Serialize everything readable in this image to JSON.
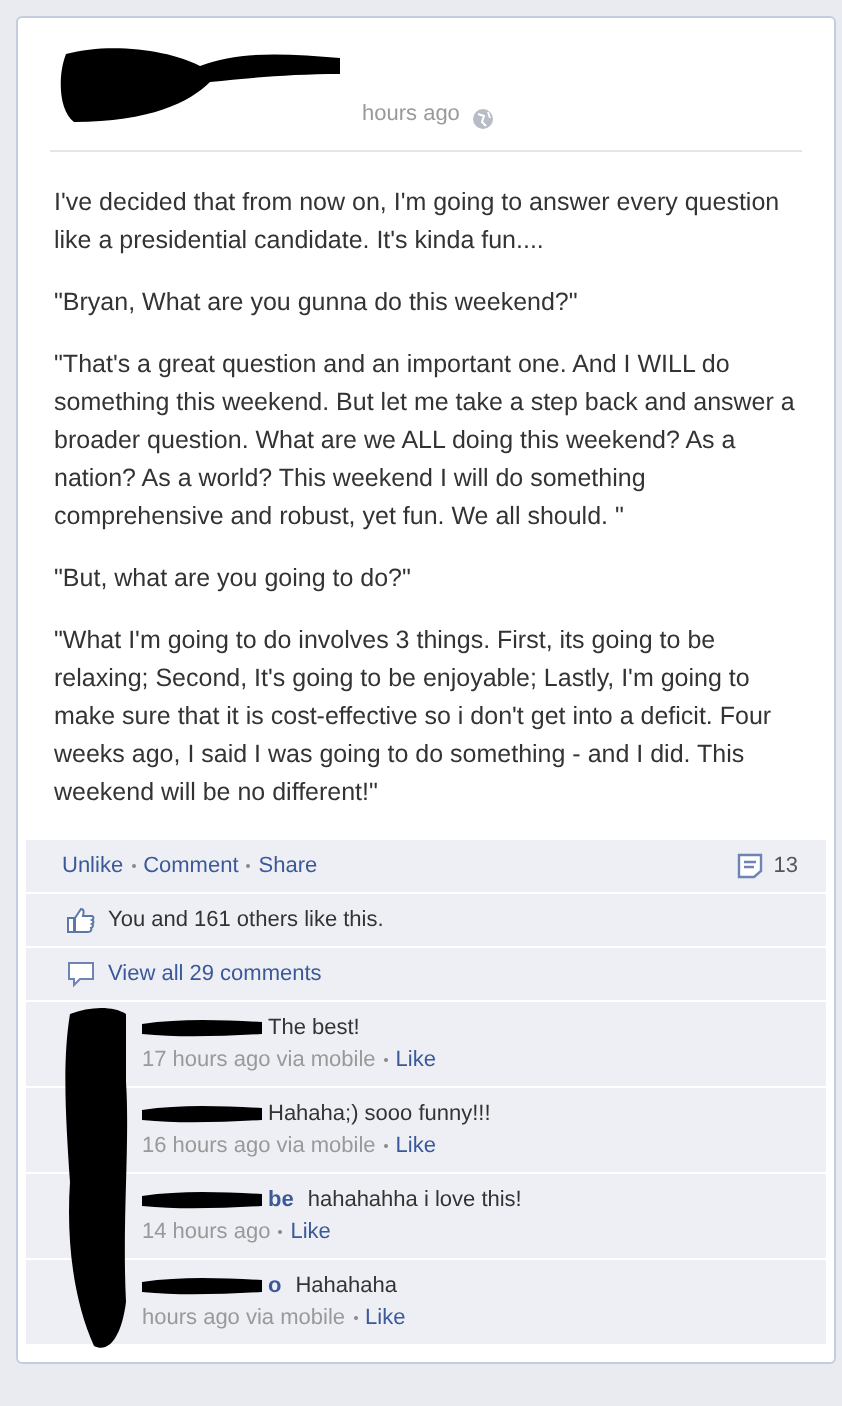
{
  "post": {
    "time": "hours ago",
    "paragraphs": [
      "I've decided that from now on, I'm going to answer every question like a presidential candidate. It's kinda fun....",
      "\"Bryan, What are you gunna do this weekend?\"",
      "\"That's a great question and an important one. And I WILL do something this weekend. But let me take a step back and answer a broader question. What are we ALL doing this weekend? As a nation? As a world? This weekend I will do something comprehensive and robust, yet fun. We all should. \"",
      "\"But, what are you going to do?\"",
      "\"What I'm going to do involves 3 things. First, its going to be relaxing; Second, It's going to be enjoyable; Lastly, I'm going to make sure that it is cost-effective so i don't get into a deficit. Four weeks ago, I said I was going to do something - and I did. This weekend will be no different!\""
    ]
  },
  "actions": [
    "Unlike",
    "Comment",
    "Share"
  ],
  "comment_count": "13",
  "likes": "You and 161 others like this.",
  "view_all": "View all 29 comments",
  "comments": [
    {
      "text": "The best!",
      "time": "17 hours ago via mobile",
      "like": "Like"
    },
    {
      "text": "Hahaha;) sooo funny!!!",
      "time": "16 hours ago via mobile",
      "like": "Like"
    },
    {
      "author": "be",
      "text": "hahahahha i love this!",
      "time": "14 hours ago",
      "like": "Like"
    },
    {
      "author": "o",
      "text": "Hahahaha",
      "time": "hours ago via mobile",
      "like": "Like"
    }
  ]
}
